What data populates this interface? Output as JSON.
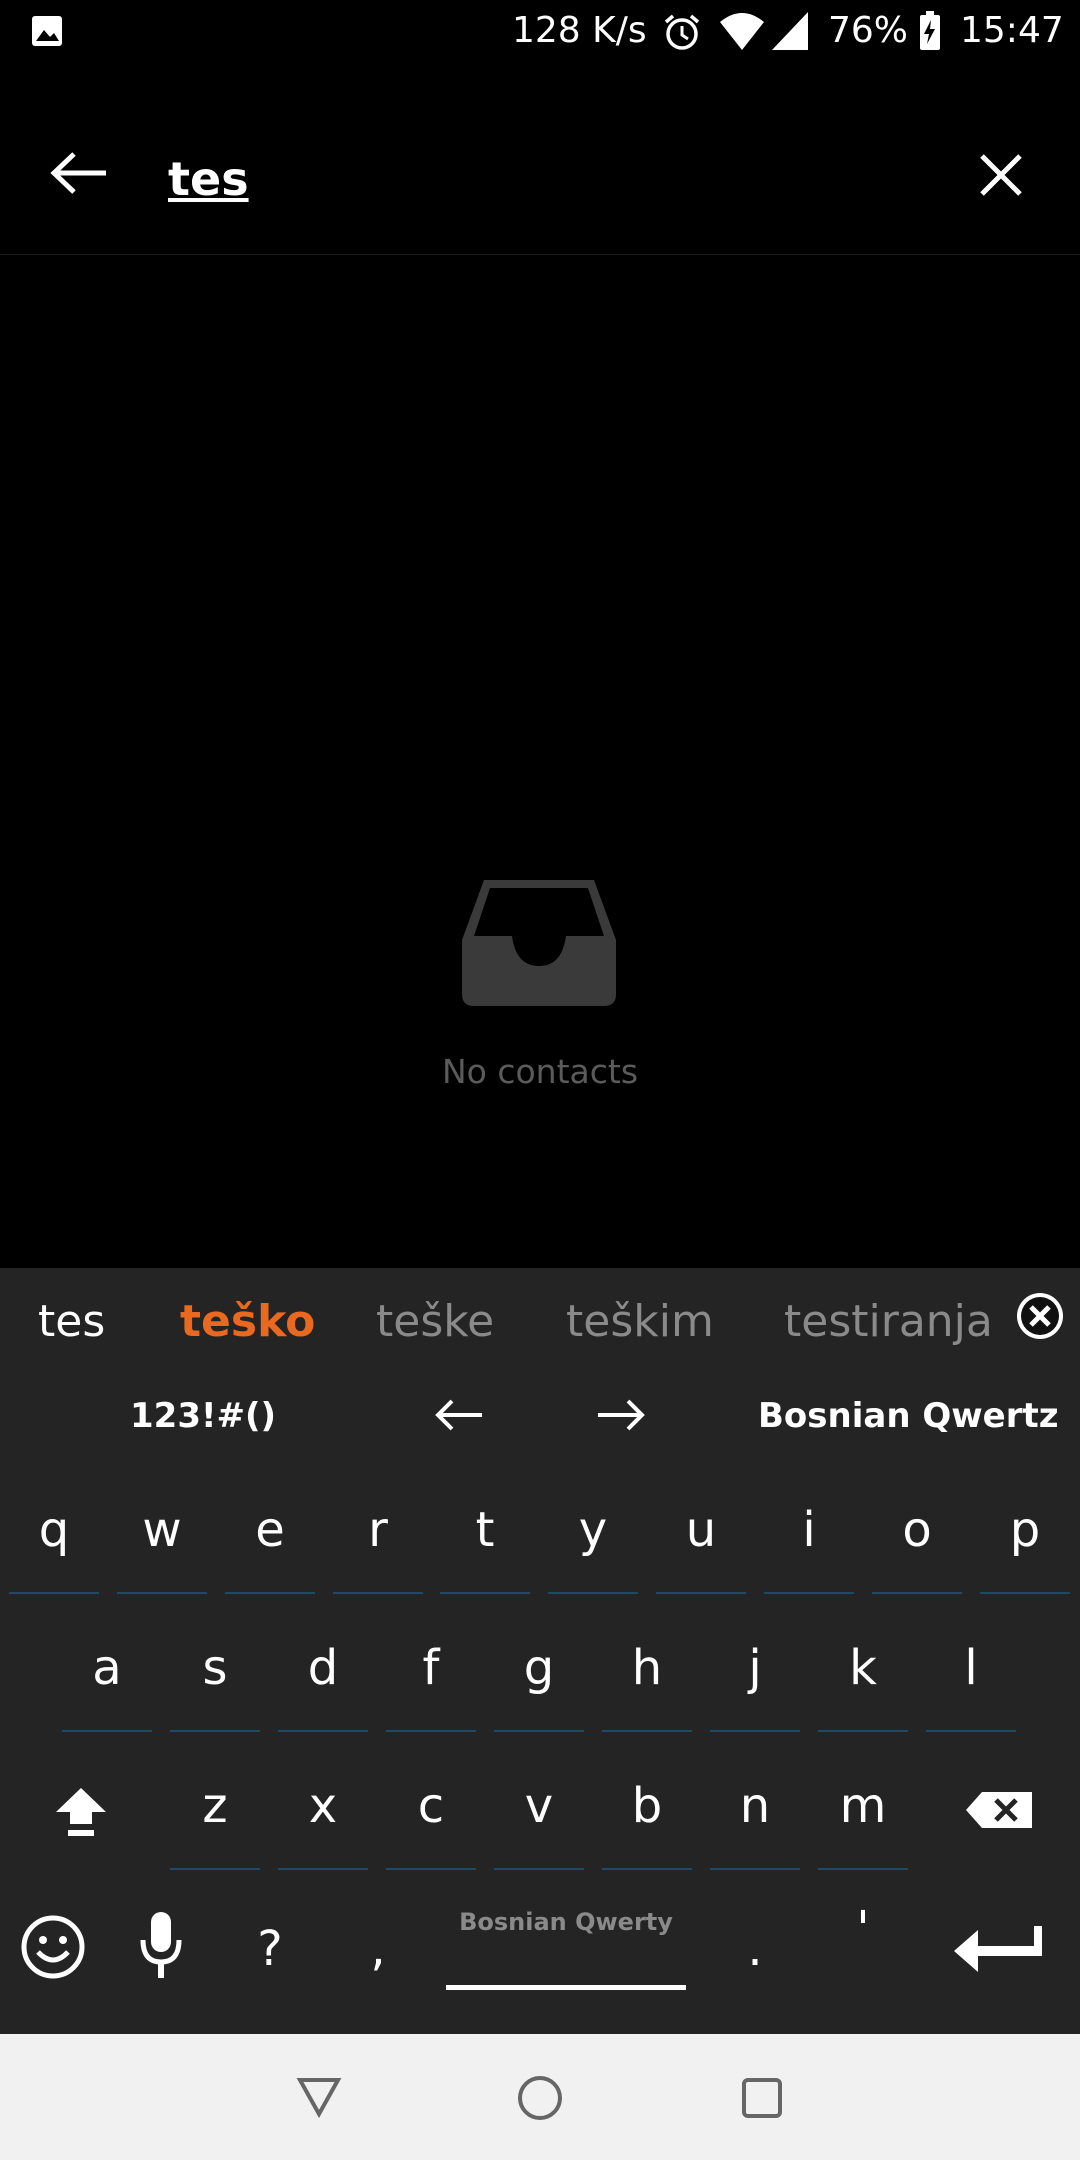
{
  "status_bar": {
    "speed": "128 K/s",
    "battery": "76%",
    "time": "15:47",
    "icons": [
      "image-icon",
      "alarm-icon",
      "wifi-icon",
      "signal-icon",
      "battery-charging-icon"
    ]
  },
  "search": {
    "query": "tes",
    "back_icon": "arrow-left-icon",
    "clear_icon": "close-icon"
  },
  "empty_state": {
    "icon": "inbox-icon",
    "label": "No contacts"
  },
  "keyboard": {
    "suggestions": [
      "tes",
      "teško",
      "teške",
      "teškim",
      "testiranja"
    ],
    "highlight_color": "#e8691f",
    "toolbar": {
      "symbols": "123!#()",
      "layout": "Bosnian Qwertz"
    },
    "row1": [
      "q",
      "w",
      "e",
      "r",
      "t",
      "y",
      "u",
      "i",
      "o",
      "p"
    ],
    "row2": [
      "a",
      "s",
      "d",
      "f",
      "g",
      "h",
      "j",
      "k",
      "l"
    ],
    "row3": [
      "z",
      "x",
      "c",
      "v",
      "b",
      "n",
      "m"
    ],
    "bottom": {
      "question": "?",
      "comma": ",",
      "space_label": "Bosnian Qwerty",
      "period": ".",
      "apostrophe": "'"
    }
  },
  "navbar": {
    "icons": [
      "back-triangle-icon",
      "home-circle-icon",
      "recents-square-icon"
    ]
  }
}
